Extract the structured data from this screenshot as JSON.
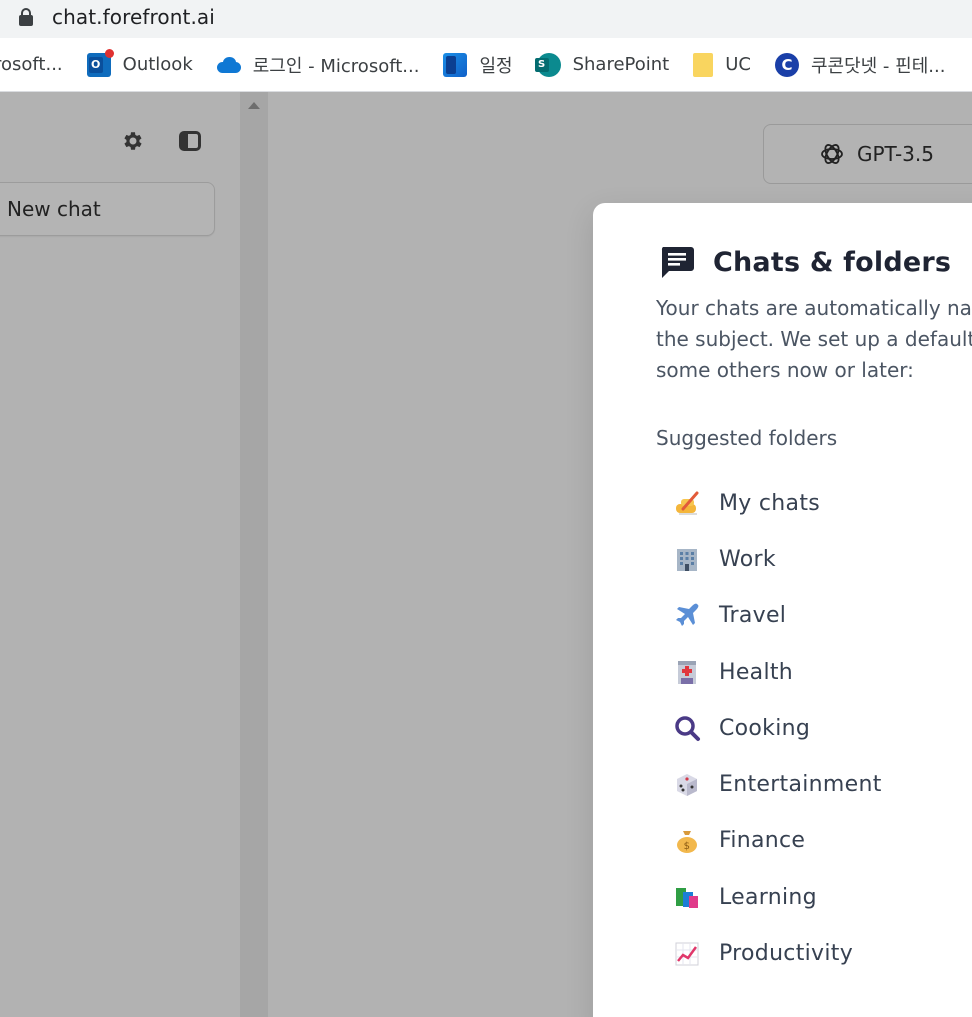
{
  "browser": {
    "url": "chat.forefront.ai",
    "bookmarks": [
      {
        "label": "rosoft...",
        "icon": "none"
      },
      {
        "label": "Outlook",
        "icon": "outlook-icon"
      },
      {
        "label": "로그인 - Microsoft...",
        "icon": "onedrive-icon"
      },
      {
        "label": "일정",
        "icon": "calendar-icon"
      },
      {
        "label": "SharePoint",
        "icon": "sharepoint-icon"
      },
      {
        "label": "UC",
        "icon": "folder-icon"
      },
      {
        "label": "쿠콘닷넷 - 핀테...",
        "icon": "coocon-icon"
      }
    ]
  },
  "sidebar": {
    "new_chat_label": "New chat"
  },
  "header": {
    "model_label": "GPT-3.5"
  },
  "modal": {
    "title": "Chats & folders",
    "description_lines": [
      "Your chats are automatically nar",
      "the subject. We set up a default",
      "some others now or later:"
    ],
    "suggested_label": "Suggested folders",
    "folders": [
      {
        "label": "My chats",
        "icon": "writing-hand-icon"
      },
      {
        "label": "Work",
        "icon": "office-building-icon"
      },
      {
        "label": "Travel",
        "icon": "airplane-icon"
      },
      {
        "label": "Health",
        "icon": "hospital-icon"
      },
      {
        "label": "Cooking",
        "icon": "magnifier-icon"
      },
      {
        "label": "Entertainment",
        "icon": "dice-icon"
      },
      {
        "label": "Finance",
        "icon": "money-bag-icon"
      },
      {
        "label": "Learning",
        "icon": "books-icon"
      },
      {
        "label": "Productivity",
        "icon": "chart-increasing-icon"
      }
    ]
  },
  "colors": {
    "overlay": "#b2b2b2",
    "modal_bg": "#ffffff",
    "title": "#1f2433",
    "body_text": "#4b5563"
  }
}
